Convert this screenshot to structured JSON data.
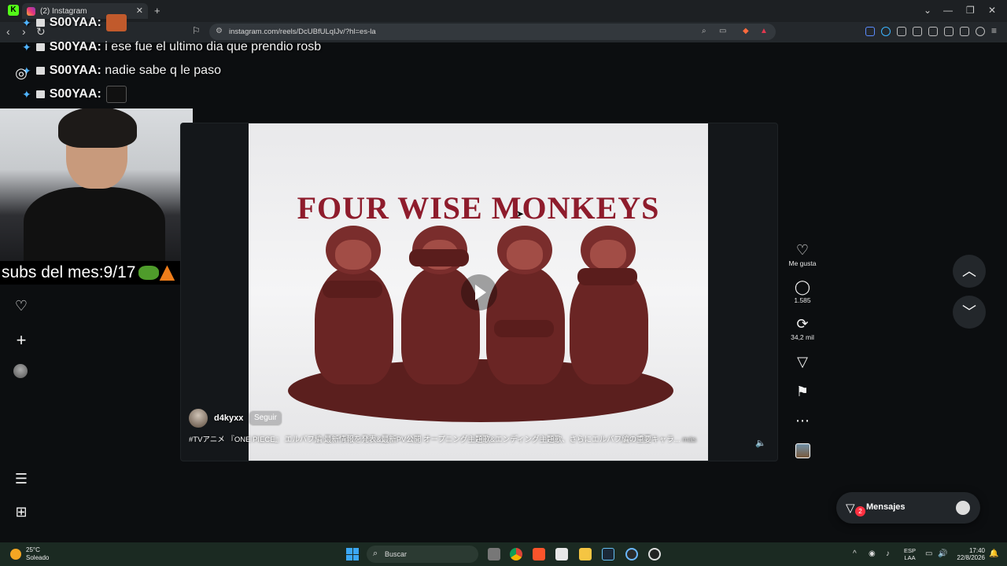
{
  "browser": {
    "tab_title": "(2) Instagram",
    "url": "instagram.com/reels/DcUBfULqIJv/?hl=es-la"
  },
  "chat": [
    {
      "user": "S00YAA:",
      "text": ""
    },
    {
      "user": "S00YAA:",
      "text": " i ese fue el ultimo dia que prendio rosb"
    },
    {
      "user": "S00YAA:",
      "text": " nadie sabe q le paso"
    },
    {
      "user": "S00YAA:",
      "text": ""
    }
  ],
  "stream": {
    "subs_label": "subs del mes:9/17"
  },
  "reel": {
    "overlay_title": "FOUR  WISE  MONKEYS",
    "author": "d4kyxx",
    "follow_label": "Seguir",
    "caption": "#TVアニメ 『ONE PIECE』 エルバフ編 最新情報を発表&最新PV公開 オープニング主題歌&エンディング主題歌、さらにエルバフ編の重要キャラ...",
    "caption_more": "más",
    "actions": {
      "like_label": "Me gusta",
      "comments_count": "1.585",
      "reposts_count": "34,2 mil"
    }
  },
  "messages": {
    "label": "Mensajes",
    "badge": "2"
  },
  "taskbar": {
    "temp": "25°C",
    "condition": "Soleado",
    "search_label": "Buscar",
    "lang_top": "ESP",
    "lang_bottom": "LAA",
    "time": "17:40",
    "date": "22/8/2026"
  },
  "colors": {
    "instagram_bg": "#0c0e10",
    "title_red": "#8e1c2c",
    "badge_red": "#ff3040"
  }
}
